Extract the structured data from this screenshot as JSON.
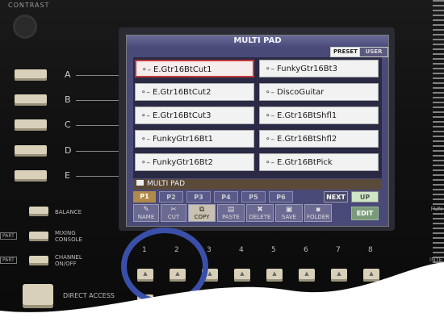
{
  "panel": {
    "contrast_label": "CONTRAST",
    "side_buttons": [
      "A",
      "B",
      "C",
      "D",
      "E"
    ],
    "balance_label": "BALANCE",
    "mixing_console_label": "MIXING CONSOLE",
    "channel_label": "CHANNEL ON/OFF",
    "part_label": "PART",
    "direct_access_label": "DIRECT ACCESS",
    "right_labels": [
      "FUN",
      "INTE"
    ]
  },
  "screen": {
    "title": "MULTI PAD",
    "tabs": {
      "preset": "PRESET",
      "user": "USER"
    },
    "pads": [
      {
        "label": "E.Gtr16BtCut1",
        "selected": true
      },
      {
        "label": "FunkyGtr16Bt3",
        "selected": false
      },
      {
        "label": "E.Gtr16BtCut2",
        "selected": false
      },
      {
        "label": "DiscoGuitar",
        "selected": false
      },
      {
        "label": "E.Gtr16BtCut3",
        "selected": false
      },
      {
        "label": "E.Gtr16BtShfl1",
        "selected": false
      },
      {
        "label": "FunkyGtr16Bt1",
        "selected": false
      },
      {
        "label": "E.Gtr16BtShfl2",
        "selected": false
      },
      {
        "label": "FunkyGtr16Bt2",
        "selected": false
      },
      {
        "label": "E.Gtr16BtPick",
        "selected": false
      }
    ],
    "folder": "MULTI PAD",
    "pages": [
      "P1",
      "P2",
      "P3",
      "P4",
      "P5",
      "P6"
    ],
    "next_label": "NEXT",
    "up_label": "UP",
    "functions": [
      {
        "label": "NAME",
        "active": false
      },
      {
        "label": "CUT",
        "active": false
      },
      {
        "label": "COPY",
        "active": true
      },
      {
        "label": "PASTE",
        "active": false
      },
      {
        "label": "DELETE",
        "active": false
      },
      {
        "label": "SAVE",
        "active": false
      },
      {
        "label": "FOLDER",
        "active": false
      }
    ],
    "edit_label": "EDIT"
  },
  "bottom_numbers": [
    "1",
    "2",
    "3",
    "4",
    "5",
    "6",
    "7",
    "8"
  ],
  "colors": {
    "highlight_circle": "#3a4fa8",
    "selected_border": "#c03a3a",
    "lcd_bg": "#4a4a78"
  }
}
